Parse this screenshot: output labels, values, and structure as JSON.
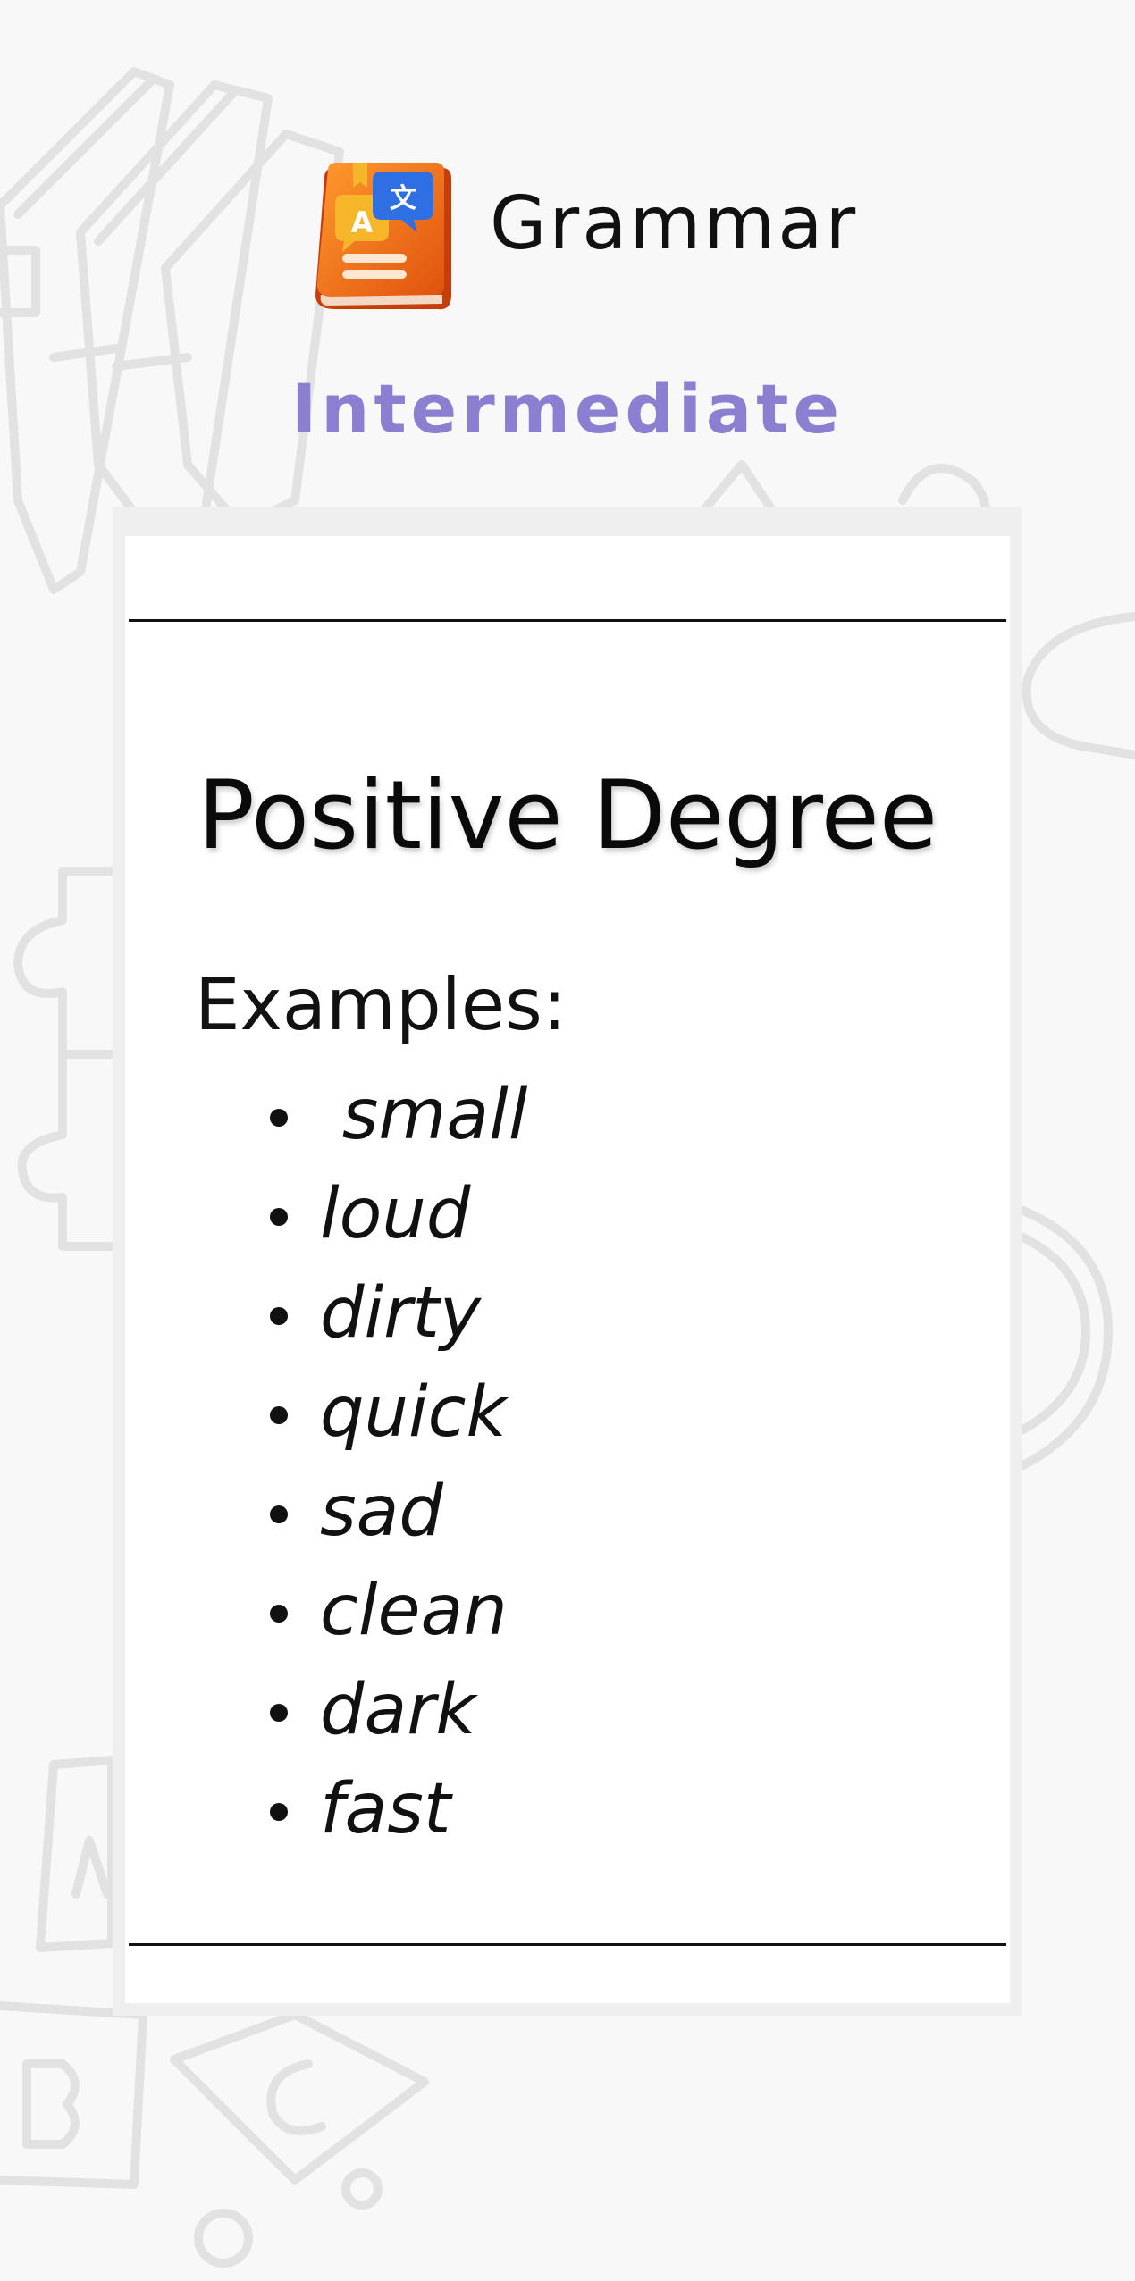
{
  "header": {
    "app_name": "Grammar",
    "level": "Intermediate",
    "logo_icon": "grammar-book-translate-icon"
  },
  "card": {
    "title": "Positive Degree",
    "examples_label": "Examples:",
    "examples": [
      " small",
      "loud",
      "dirty",
      "quick",
      "sad",
      "clean",
      "dark",
      "fast"
    ]
  },
  "colors": {
    "level_accent": "#8a7fd0",
    "logo_orange": "#f07417",
    "logo_blue": "#2f6fe4",
    "logo_yellow": "#f5b62a",
    "background": "#f8f8f8"
  }
}
